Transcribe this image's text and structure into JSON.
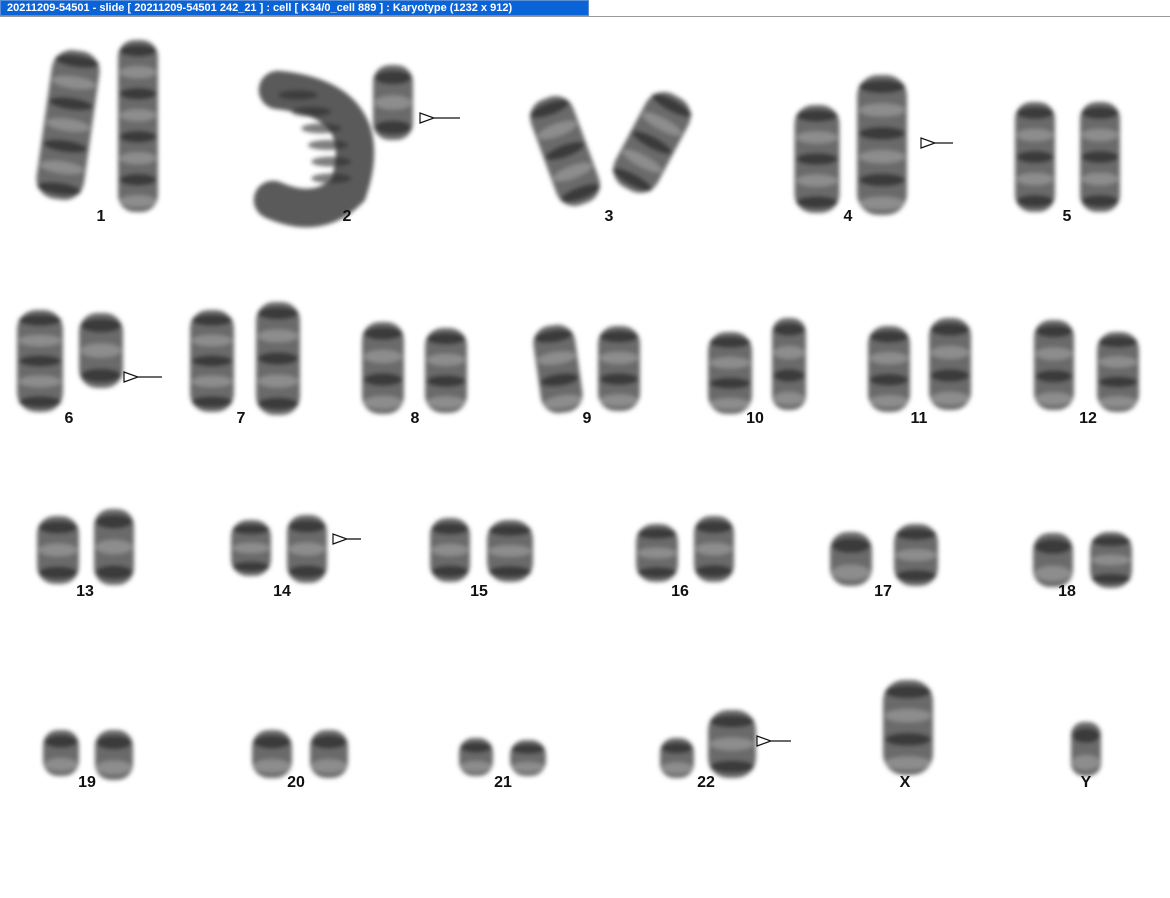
{
  "window": {
    "title": "20211209-54501 - slide [ 20211209-54501 242_21 ] : cell [ K34/0_cell 889 ] : Karyotype  (1232 x 912)"
  },
  "karyotype": {
    "chromosome_labels": [
      "1",
      "2",
      "3",
      "4",
      "5",
      "6",
      "7",
      "8",
      "9",
      "10",
      "11",
      "12",
      "13",
      "14",
      "15",
      "16",
      "17",
      "18",
      "19",
      "20",
      "21",
      "22",
      "X",
      "Y"
    ],
    "marked_abnormal": [
      "2",
      "4",
      "6",
      "14",
      "22"
    ]
  },
  "colors": {
    "title_bar": "#0a64d8",
    "background": "#ffffff",
    "chromosome": "#3a3a3a"
  }
}
